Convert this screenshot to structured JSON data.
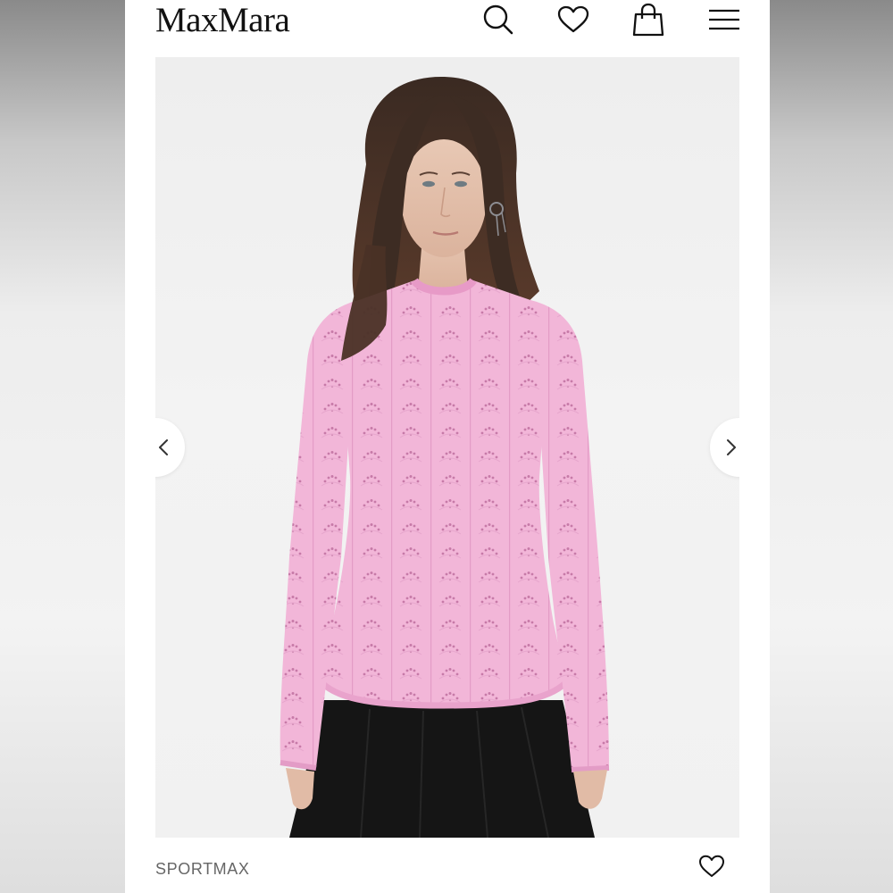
{
  "header": {
    "logo_text": "MaxMara",
    "icons": {
      "search": "search-icon",
      "wishlist": "heart-icon",
      "bag": "shopping-bag-icon",
      "menu": "hamburger-menu-icon"
    }
  },
  "gallery": {
    "image_subject": "model-wearing-pink-pointelle-knit-sweater",
    "prev_icon": "chevron-left-icon",
    "next_icon": "chevron-right-icon"
  },
  "product": {
    "brand": "SPORTMAX",
    "favorite_icon": "heart-outline-icon"
  },
  "colors": {
    "sweater_pink": "#f2b6d8",
    "skirt_black": "#151515",
    "text_primary": "#111111",
    "text_secondary": "#666666",
    "background": "#ffffff"
  }
}
